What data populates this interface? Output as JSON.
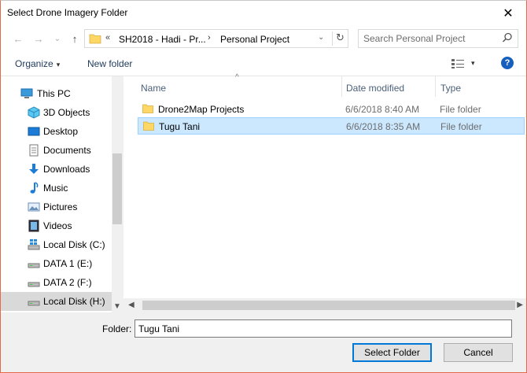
{
  "window": {
    "title": "Select Drone Imagery Folder",
    "close_glyph": "✕"
  },
  "nav": {
    "back_glyph": "←",
    "forward_glyph": "→",
    "recent_glyph": "⌄",
    "up_glyph": "↑",
    "address": {
      "overflow": "«",
      "crumbs": [
        "SH2018 - Hadi - Pr...",
        "Personal Project"
      ],
      "separator": "›",
      "dropdown_glyph": "⌄",
      "refresh_glyph": "↻"
    },
    "search_placeholder": "Search Personal Project"
  },
  "toolbar": {
    "organize": "Organize",
    "caret": "▾",
    "new_folder": "New folder",
    "help": "?"
  },
  "sidebar": {
    "items": [
      {
        "label": "This PC",
        "icon": "computer-icon"
      },
      {
        "label": "3D Objects",
        "icon": "cube-icon"
      },
      {
        "label": "Desktop",
        "icon": "desktop-icon"
      },
      {
        "label": "Documents",
        "icon": "documents-icon"
      },
      {
        "label": "Downloads",
        "icon": "downloads-icon"
      },
      {
        "label": "Music",
        "icon": "music-icon"
      },
      {
        "label": "Pictures",
        "icon": "pictures-icon"
      },
      {
        "label": "Videos",
        "icon": "videos-icon"
      },
      {
        "label": "Local Disk (C:)",
        "icon": "windows-drive-icon"
      },
      {
        "label": "DATA 1 (E:)",
        "icon": "drive-icon"
      },
      {
        "label": "DATA 2 (F:)",
        "icon": "drive-icon"
      },
      {
        "label": "Local Disk (H:)",
        "icon": "drive-icon"
      }
    ]
  },
  "files": {
    "columns": {
      "name": "Name",
      "date": "Date modified",
      "type": "Type"
    },
    "rows": [
      {
        "name": "Drone2Map Projects",
        "date": "6/6/2018 8:40 AM",
        "type": "File folder"
      },
      {
        "name": "Tugu Tani",
        "date": "6/6/2018 8:35 AM",
        "type": "File folder"
      }
    ]
  },
  "footer": {
    "folder_label": "Folder:",
    "folder_value": "Tugu Tani",
    "select_label": "Select Folder",
    "cancel_label": "Cancel"
  },
  "colors": {
    "accent": "#0078d7",
    "selection": "#cce8ff",
    "folder": "#ffd766"
  }
}
